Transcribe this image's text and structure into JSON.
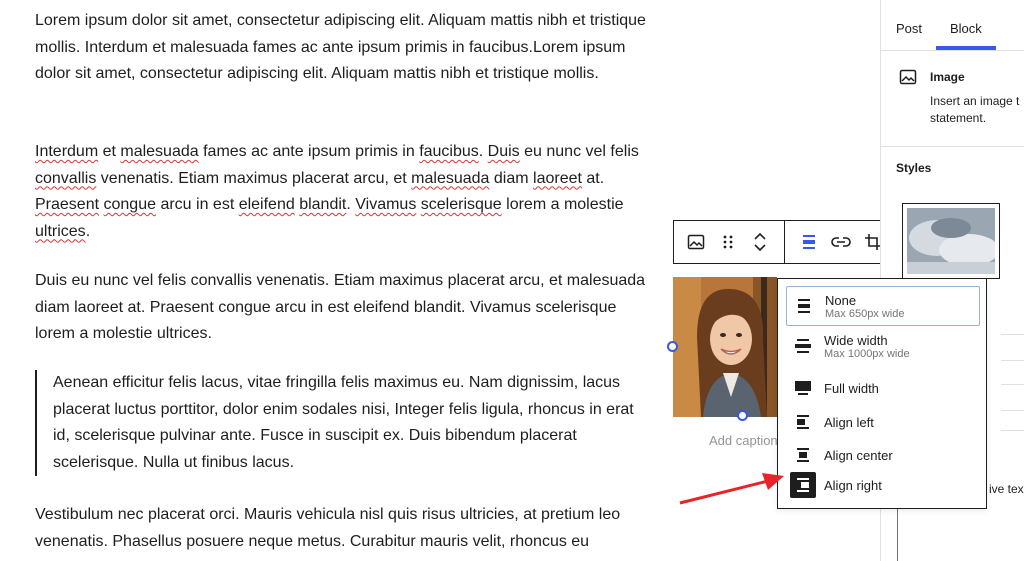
{
  "content": {
    "p1": "Lorem ipsum dolor sit amet, consectetur adipiscing elit. Aliquam mattis nibh et tristique mollis. Interdum et malesuada fames ac ante ipsum primis in faucibus.Lorem ipsum dolor sit amet, consectetur adipiscing elit. Aliquam mattis nibh et tristique mollis.",
    "p2_parts": [
      "Interdum",
      " et ",
      "malesuada",
      " fames ac ante ipsum primis in ",
      "faucibus",
      ". ",
      "Duis",
      " eu nunc vel felis ",
      "convallis",
      " venenatis. Etiam maximus placerat arcu, et ",
      "malesuada",
      " diam ",
      "laoreet",
      " at. ",
      "Praesent",
      " ",
      "congue",
      " arcu in est ",
      "eleifend",
      " ",
      "blandit",
      ". ",
      "Vivamus",
      " ",
      "scelerisque",
      " lorem a molestie ",
      "ultrices",
      "."
    ],
    "p3": "Duis eu nunc vel felis convallis venenatis. Etiam maximus placerat arcu, et malesuada diam laoreet at. Praesent congue arcu in est eleifend blandit. Vivamus scelerisque lorem a molestie ultrices.",
    "quote": "Aenean efficitur felis lacus, vitae fringilla felis maximus eu. Nam dignissim, lacus placerat luctus porttitor, dolor enim sodales nisi, Integer felis ligula, rhoncus in erat id, scelerisque pulvinar ante. Fusce in suscipit ex. Duis bibendum placerat scelerisque. Nulla ut finibus lacus.",
    "p4": "Vestibulum nec placerat orci. Mauris vehicula nisl quis risus ultricies, at pretium leo venenatis. Phasellus posuere neque metus. Curabitur mauris velit, rhoncus eu"
  },
  "image": {
    "caption_placeholder": "Add caption"
  },
  "align_menu": {
    "items": [
      {
        "label": "None",
        "sub": "Max 650px wide",
        "icon": "align-none-icon"
      },
      {
        "label": "Wide width",
        "sub": "Max 1000px wide",
        "icon": "align-wide-icon"
      },
      {
        "label": "Full width",
        "sub": "",
        "icon": "align-full-icon"
      },
      {
        "label": "Align left",
        "sub": "",
        "icon": "align-left-icon"
      },
      {
        "label": "Align center",
        "sub": "",
        "icon": "align-center-icon"
      },
      {
        "label": "Align right",
        "sub": "",
        "icon": "align-right-icon"
      }
    ]
  },
  "sidebar": {
    "tabs": [
      "Post",
      "Block"
    ],
    "active_tab": "Block",
    "block_title": "Image",
    "block_desc_1": "Insert an image t",
    "block_desc_2": "statement.",
    "styles_heading": "Styles",
    "partial_text": "ive tex"
  },
  "colors": {
    "accent": "#3858e9",
    "arrow": "#e8232a"
  }
}
